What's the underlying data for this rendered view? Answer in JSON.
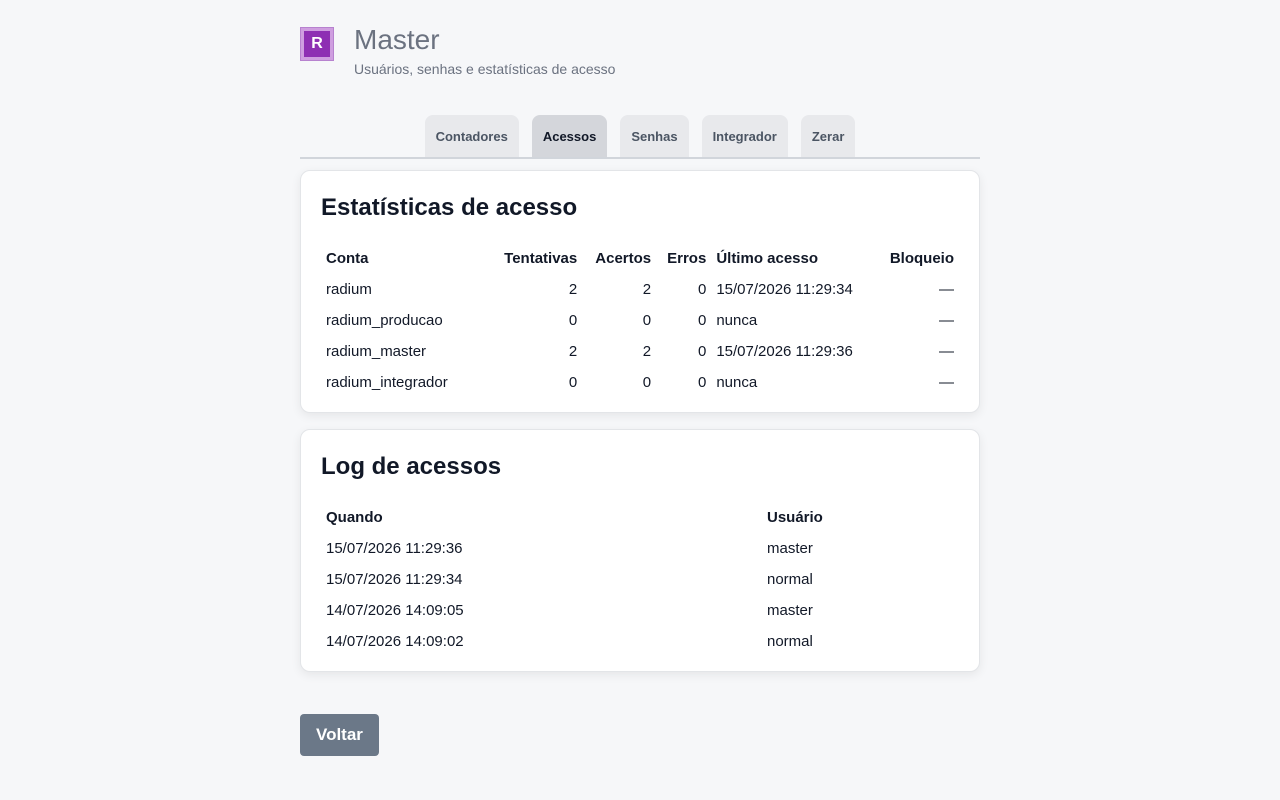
{
  "header": {
    "logo_letter": "R",
    "title": "Master",
    "subtitle": "Usuários, senhas e estatísticas de acesso"
  },
  "tabs": [
    {
      "label": "Contadores",
      "active": false
    },
    {
      "label": "Acessos",
      "active": true
    },
    {
      "label": "Senhas",
      "active": false
    },
    {
      "label": "Integrador",
      "active": false
    },
    {
      "label": "Zerar",
      "active": false
    }
  ],
  "stats": {
    "title": "Estatísticas de acesso",
    "columns": [
      "Conta",
      "Tentativas",
      "Acertos",
      "Erros",
      "Último acesso",
      "Bloqueio"
    ],
    "rows": [
      [
        "radium",
        "2",
        "2",
        "0",
        "15/07/2026 11:29:34",
        "—"
      ],
      [
        "radium_producao",
        "0",
        "0",
        "0",
        "nunca",
        "—"
      ],
      [
        "radium_master",
        "2",
        "2",
        "0",
        "15/07/2026 11:29:36",
        "—"
      ],
      [
        "radium_integrador",
        "0",
        "0",
        "0",
        "nunca",
        "—"
      ]
    ]
  },
  "log": {
    "title": "Log de acessos",
    "columns": [
      "Quando",
      "Usuário"
    ],
    "rows": [
      [
        "15/07/2026 11:29:36",
        "master"
      ],
      [
        "15/07/2026 11:29:34",
        "normal"
      ],
      [
        "14/07/2026 14:09:05",
        "master"
      ],
      [
        "14/07/2026 14:09:02",
        "normal"
      ]
    ]
  },
  "back_button": "Voltar",
  "colors": {
    "logo_bg": "#cf9ee0",
    "logo_inner": "#8e2fb3",
    "button_bg": "#6b7888"
  }
}
